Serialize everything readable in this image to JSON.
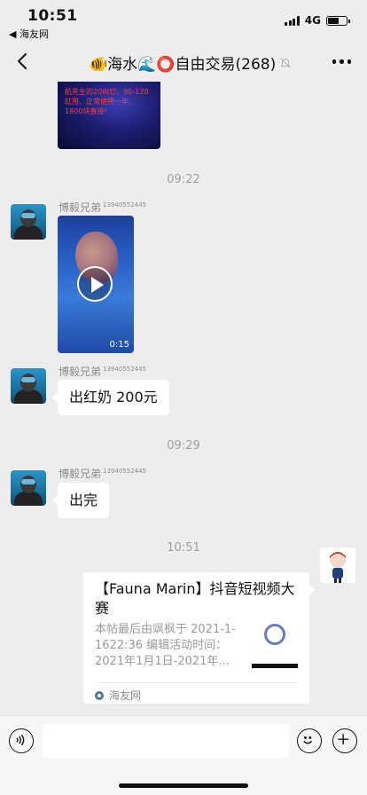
{
  "status_bar": {
    "time": "10:51",
    "back_app": "◀ 海友网",
    "network": "4G",
    "battery_level": 0.6
  },
  "nav": {
    "title": "🐠海水🌊⭕自由交易(268)"
  },
  "messages": {
    "image_top_text": "航先生的20W灯、90-120缸用、正常使用一年、1800块直接!",
    "ts1": "09:22",
    "sender1": "博毅兄弟",
    "sender1_sub": "13940552445",
    "video_duration": "0:15",
    "sender2": "博毅兄弟",
    "sender2_sub": "13940552445",
    "text2": "出红奶 200元",
    "ts2": "09:29",
    "sender3": "博毅兄弟",
    "sender3_sub": "13940552445",
    "text3": "出完",
    "ts3": "10:51"
  },
  "card": {
    "title": "【Fauna Marin】抖音短视频大赛",
    "desc": "本帖最后由飒枫于 2021-1-1622:36 编辑活动时间：2021年1月1日-2021年...",
    "source": "海友网"
  },
  "icons": {
    "back": "chevron-left-icon",
    "mute": "bell-mute-icon",
    "more": "more-dots-icon",
    "voice": "voice-icon",
    "emoji": "emoji-icon",
    "plus": "plus-icon"
  }
}
